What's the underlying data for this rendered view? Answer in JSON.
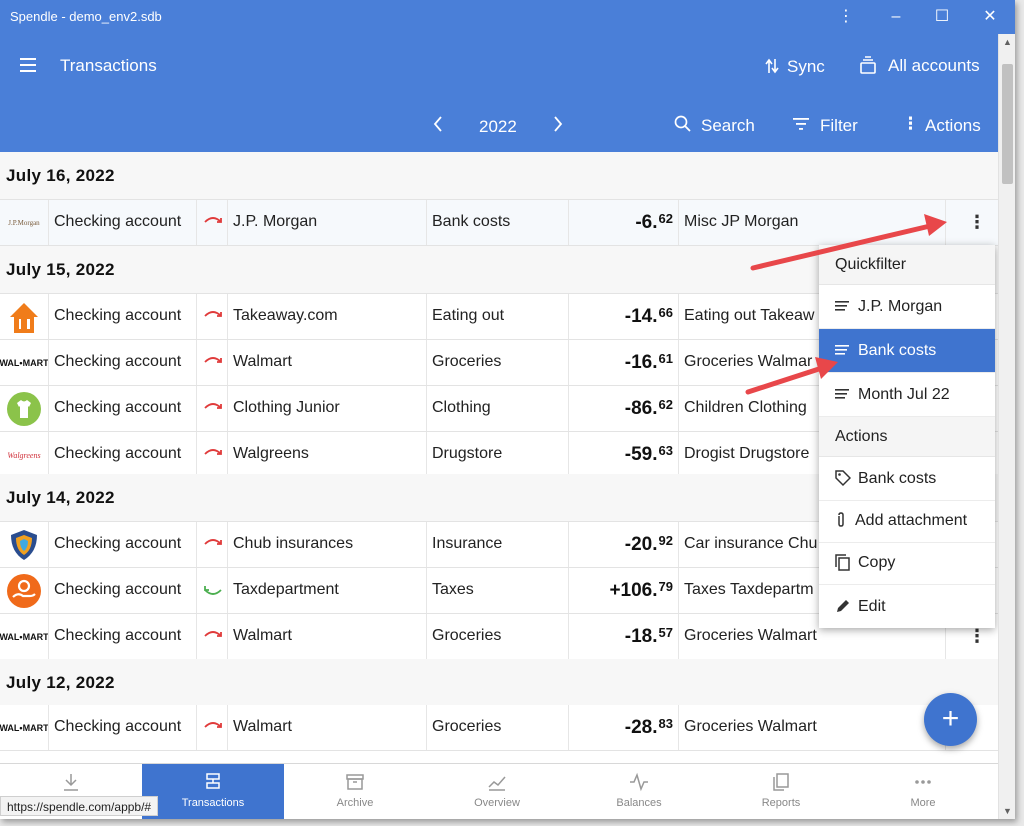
{
  "window": {
    "title": "Spendle - demo_env2.sdb"
  },
  "appbar": {
    "title": "Transactions",
    "sync": "Sync",
    "accounts": "All accounts",
    "year": "2022",
    "search": "Search",
    "filter": "Filter",
    "actions": "Actions"
  },
  "groups": [
    {
      "date": "July 16, 2022",
      "rows": [
        {
          "logo_text": "J.P.Morgan",
          "account": "Checking account",
          "payee": "J.P. Morgan",
          "category": "Bank costs",
          "amount": "-6.",
          "cents": "62",
          "description": "Misc JP Morgan"
        }
      ]
    },
    {
      "date": "July 15, 2022",
      "rows": [
        {
          "account": "Checking account",
          "payee": "Takeaway.com",
          "category": "Eating out",
          "amount": "-14.",
          "cents": "66",
          "description": "Eating out Takeaw"
        },
        {
          "logo_text": "WAL•MART",
          "account": "Checking account",
          "payee": "Walmart",
          "category": "Groceries",
          "amount": "-16.",
          "cents": "61",
          "description": "Groceries Walmar"
        },
        {
          "account": "Checking account",
          "payee": "Clothing Junior",
          "category": "Clothing",
          "amount": "-86.",
          "cents": "62",
          "description": "Children Clothing"
        },
        {
          "logo_text": "Walgreens",
          "account": "Checking account",
          "payee": "Walgreens",
          "category": "Drugstore",
          "amount": "-59.",
          "cents": "63",
          "description": "Drogist Drugstore"
        }
      ]
    },
    {
      "date": "July 14, 2022",
      "rows": [
        {
          "account": "Checking account",
          "payee": "Chub insurances",
          "category": "Insurance",
          "amount": "-20.",
          "cents": "92",
          "description": "Car insurance Chu"
        },
        {
          "account": "Checking account",
          "payee": "Taxdepartment",
          "category": "Taxes",
          "amount": "+106.",
          "cents": "79",
          "description": "Taxes Taxdepartm"
        },
        {
          "logo_text": "WAL•MART",
          "account": "Checking account",
          "payee": "Walmart",
          "category": "Groceries",
          "amount": "-18.",
          "cents": "57",
          "description": "Groceries Walmart"
        }
      ]
    },
    {
      "date": "July 12, 2022",
      "rows": [
        {
          "logo_text": "WAL•MART",
          "account": "Checking account",
          "payee": "Walmart",
          "category": "Groceries",
          "amount": "-28.",
          "cents": "83",
          "description": "Groceries Walmart"
        }
      ]
    }
  ],
  "context_menu": {
    "quickfilter_header": "Quickfilter",
    "quickfilter": [
      "J.P. Morgan",
      "Bank costs",
      "Month Jul 22"
    ],
    "actions_header": "Actions",
    "actions": [
      "Bank costs",
      "Add attachment",
      "Copy",
      "Edit"
    ]
  },
  "bottom_nav": [
    "",
    "Transactions",
    "Archive",
    "Overview",
    "Balances",
    "Reports",
    "More"
  ],
  "status_url": "https://spendle.com/appb/#",
  "colors": {
    "primary": "#4a7fd8",
    "selected": "#3f74cf",
    "expense_arrow": "#e03b3b",
    "income_arrow": "#4caf50",
    "annotation": "#e8474a"
  }
}
